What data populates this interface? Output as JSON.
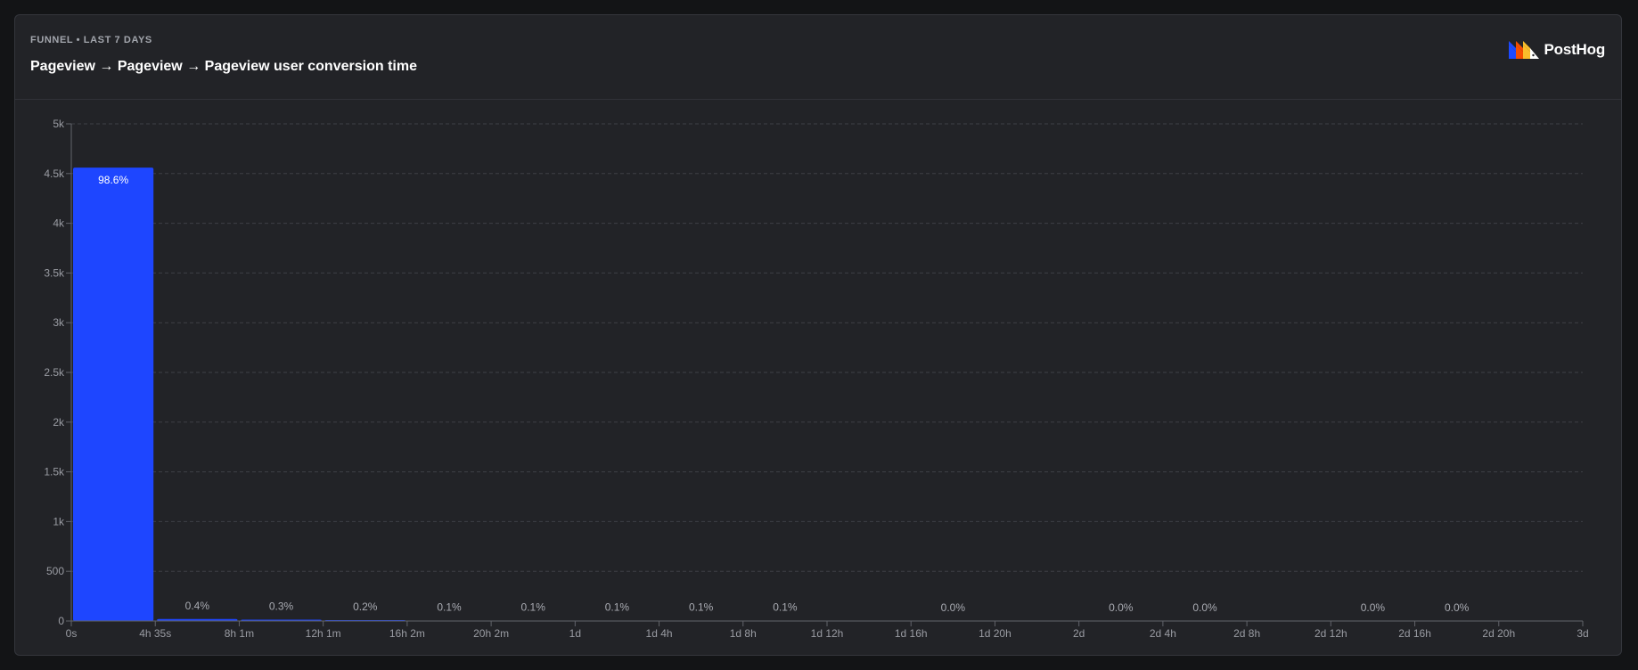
{
  "header": {
    "subtitle": "FUNNEL • LAST 7 DAYS",
    "title": "Pageview → Pageview → Pageview user conversion time",
    "brand": "PostHog"
  },
  "colors": {
    "bar": "#1e46ff",
    "grid": "#3e4047",
    "axis": "#62646b",
    "background": "#222327"
  },
  "chart_data": {
    "type": "bar",
    "title": "Pageview → Pageview → Pageview user conversion time",
    "xlabel": "",
    "ylabel": "",
    "ylim": [
      0,
      5000
    ],
    "grid": true,
    "y_ticks": [
      "0",
      "500",
      "1k",
      "1.5k",
      "2k",
      "2.5k",
      "3k",
      "3.5k",
      "4k",
      "4.5k",
      "5k"
    ],
    "y_tick_values": [
      0,
      500,
      1000,
      1500,
      2000,
      2500,
      3000,
      3500,
      4000,
      4500,
      5000
    ],
    "x_ticks": [
      "0s",
      "4h 35s",
      "8h 1m",
      "12h 1m",
      "16h 2m",
      "20h 2m",
      "1d",
      "1d 4h",
      "1d 8h",
      "1d 12h",
      "1d 16h",
      "1d 20h",
      "2d",
      "2d 4h",
      "2d 8h",
      "2d 12h",
      "2d 16h",
      "2d 20h",
      "3d"
    ],
    "bins": [
      {
        "value": 4560,
        "label": "98.6%"
      },
      {
        "value": 20,
        "label": "0.4%"
      },
      {
        "value": 13,
        "label": "0.3%"
      },
      {
        "value": 9,
        "label": "0.2%"
      },
      {
        "value": 5,
        "label": "0.1%"
      },
      {
        "value": 4,
        "label": "0.1%"
      },
      {
        "value": 4,
        "label": "0.1%"
      },
      {
        "value": 3,
        "label": "0.1%"
      },
      {
        "value": 4,
        "label": "0.1%"
      },
      {
        "value": 0,
        "label": ""
      },
      {
        "value": 1,
        "label": "0.0%"
      },
      {
        "value": 0,
        "label": ""
      },
      {
        "value": 1,
        "label": "0.0%"
      },
      {
        "value": 1,
        "label": "0.0%"
      },
      {
        "value": 0,
        "label": ""
      },
      {
        "value": 1,
        "label": "0.0%"
      },
      {
        "value": 1,
        "label": "0.0%"
      },
      {
        "value": 0,
        "label": ""
      }
    ]
  }
}
